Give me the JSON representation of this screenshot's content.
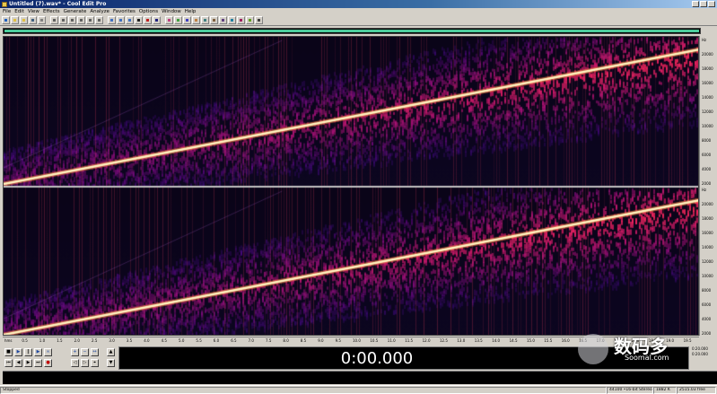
{
  "window": {
    "title": "Untitled (7).wav* - Cool Edit Pro"
  },
  "menu": [
    "File",
    "Edit",
    "View",
    "Effects",
    "Generate",
    "Analyze",
    "Favorites",
    "Options",
    "Window",
    "Help"
  ],
  "ruler_right": [
    "Hz",
    "20000",
    "18000",
    "16000",
    "14000",
    "12000",
    "10000",
    "8000",
    "6000",
    "4000",
    "2000",
    "Hz",
    "20000",
    "18000",
    "16000",
    "14000",
    "12000",
    "10000",
    "8000",
    "6000",
    "4000",
    "2000"
  ],
  "time_ruler": [
    "hms",
    "0.5",
    "1.0",
    "1.5",
    "2.0",
    "2.5",
    "3.0",
    "3.5",
    "4.0",
    "4.5",
    "5.0",
    "5.5",
    "6.0",
    "6.5",
    "7.0",
    "7.5",
    "8.0",
    "8.5",
    "9.0",
    "9.5",
    "10.0",
    "10.5",
    "11.0",
    "11.5",
    "12.0",
    "12.5",
    "13.0",
    "13.5",
    "14.0",
    "14.5",
    "15.0",
    "15.5",
    "16.0",
    "16.5",
    "17.0",
    "17.5",
    "18.0",
    "18.5",
    "19.0",
    "19.5",
    "hms"
  ],
  "time_display": "0:00.000",
  "watermark": {
    "cn": "数码多",
    "en": "Soomal.com"
  },
  "selection": {
    "begin": "0:20.000",
    "end": "0:20.000"
  },
  "status": {
    "state": "Stopped",
    "format": "44100 •16-bit Stereo",
    "size": "1882 K",
    "free": "2515.03 free"
  },
  "colors": {
    "title_start": "#0a246a",
    "overview": "#4ccc9c",
    "sweep": "#fff4c0"
  }
}
